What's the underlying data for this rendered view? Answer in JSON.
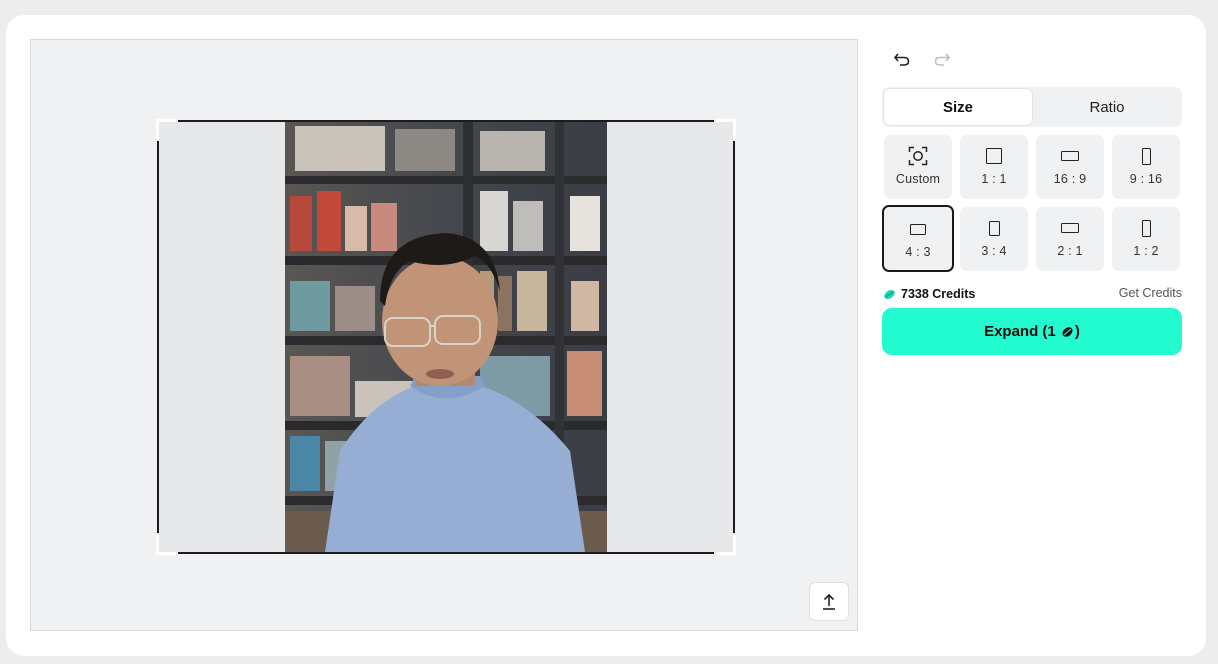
{
  "toolbar": {
    "undo_icon": "undo-icon",
    "redo_icon": "redo-icon"
  },
  "tabs": [
    {
      "label": "Size",
      "active": true
    },
    {
      "label": "Ratio",
      "active": false
    }
  ],
  "size_options": [
    {
      "label": "Custom",
      "icon": "custom-frame-icon",
      "selected": false
    },
    {
      "label": "1 : 1",
      "icon": "square-icon",
      "selected": false
    },
    {
      "label": "16 : 9",
      "icon": "landscape-wide-icon",
      "selected": false
    },
    {
      "label": "9 : 16",
      "icon": "portrait-tall-icon",
      "selected": false
    },
    {
      "label": "4 : 3",
      "icon": "landscape-icon",
      "selected": true
    },
    {
      "label": "3 : 4",
      "icon": "portrait-icon",
      "selected": false
    },
    {
      "label": "2 : 1",
      "icon": "landscape-wide-icon",
      "selected": false
    },
    {
      "label": "1 : 2",
      "icon": "portrait-tall-icon",
      "selected": false
    }
  ],
  "credits": {
    "amount_label": "7338 Credits",
    "get_label": "Get Credits"
  },
  "expand": {
    "label_prefix": "Expand (1 ",
    "label_suffix": ")"
  },
  "canvas": {
    "upload_icon": "upload-icon"
  },
  "colors": {
    "accent": "#21fbcf",
    "selected_border": "#1a1a1a",
    "panel_bg": "#f0f1f2"
  }
}
